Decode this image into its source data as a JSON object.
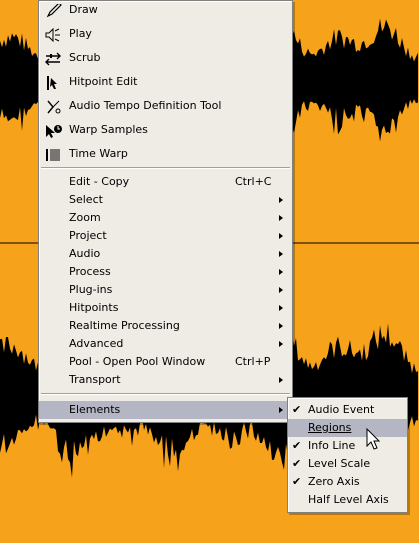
{
  "colors": {
    "wave_fill": "#f6a21a",
    "wave_dark": "#000000",
    "menu_bg": "#efece6",
    "highlight": "#b4b7c3"
  },
  "tools": [
    {
      "label": "Draw",
      "icon": "pencil-icon"
    },
    {
      "label": "Play",
      "icon": "speaker-icon"
    },
    {
      "label": "Scrub",
      "icon": "scrub-icon"
    },
    {
      "label": "Hitpoint Edit",
      "icon": "hitpoint-edit-icon"
    },
    {
      "label": "Audio Tempo Definition Tool",
      "icon": "tempo-definition-icon"
    },
    {
      "label": "Warp Samples",
      "icon": "warp-samples-icon"
    },
    {
      "label": "Time Warp",
      "icon": "time-warp-icon"
    }
  ],
  "commands": [
    {
      "label": "Edit - Copy",
      "shortcut": "Ctrl+C"
    },
    {
      "label": "Select"
    },
    {
      "label": "Zoom"
    },
    {
      "label": "Project"
    },
    {
      "label": "Audio"
    },
    {
      "label": "Process"
    },
    {
      "label": "Plug-ins"
    },
    {
      "label": "Hitpoints"
    },
    {
      "label": "Realtime Processing"
    },
    {
      "label": "Advanced"
    },
    {
      "label": "Pool - Open Pool Window",
      "shortcut": "Ctrl+P"
    },
    {
      "label": "Transport"
    }
  ],
  "elements_item": {
    "label": "Elements"
  },
  "submenu": [
    {
      "label": "Audio Event",
      "checked": true
    },
    {
      "label": "Regions",
      "checked": false
    },
    {
      "label": "Info Line",
      "checked": true
    },
    {
      "label": "Level Scale",
      "checked": true
    },
    {
      "label": "Zero Axis",
      "checked": true
    },
    {
      "label": "Half Level Axis",
      "checked": false
    }
  ],
  "check_glyph": "✔"
}
